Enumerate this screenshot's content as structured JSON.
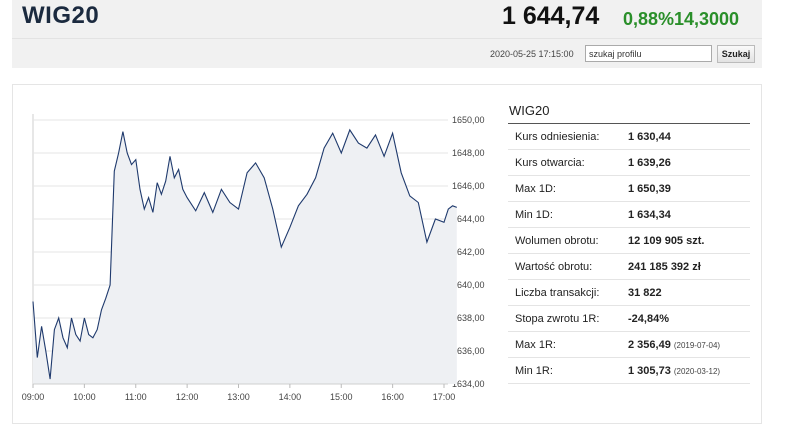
{
  "header": {
    "title": "WIG20",
    "price": "1 644,74",
    "change_pct": "0,88%",
    "change_abs": "14,3000",
    "timestamp": "2020-05-25 17:15:00",
    "search_placeholder": "szukaj profilu",
    "search_button": "Szukaj"
  },
  "stats": {
    "title": "WIG20",
    "rows": [
      {
        "label": "Kurs odniesienia:",
        "value": "1 630,44",
        "date": ""
      },
      {
        "label": "Kurs otwarcia:",
        "value": "1 639,26",
        "date": ""
      },
      {
        "label": "Max 1D:",
        "value": "1 650,39",
        "date": ""
      },
      {
        "label": "Min 1D:",
        "value": "1 634,34",
        "date": ""
      },
      {
        "label": "Wolumen obrotu:",
        "value": "12 109 905 szt.",
        "date": ""
      },
      {
        "label": "Wartość obrotu:",
        "value": "241 185 392 zł",
        "date": ""
      },
      {
        "label": "Liczba transakcji:",
        "value": "31 822",
        "date": ""
      },
      {
        "label": "Stopa zwrotu 1R:",
        "value": "-24,84%",
        "date": ""
      },
      {
        "label": "Max 1R:",
        "value": "2 356,49",
        "date": "(2019-07-04)"
      },
      {
        "label": "Min 1R:",
        "value": "1 305,73",
        "date": "(2020-03-12)"
      }
    ]
  },
  "colors": {
    "line": "#1f3a6d",
    "area": "#eef0f3",
    "up": "#2a8f2a"
  },
  "chart_data": {
    "type": "area",
    "title": "",
    "xlabel": "",
    "ylabel": "",
    "ylim": [
      1634,
      1650
    ],
    "xlim": [
      "09:00",
      "17:00"
    ],
    "y_ticks": [
      "1650,00",
      "1648,00",
      "1646,00",
      "1644,00",
      "1642,00",
      "1640,00",
      "1638,00",
      "1636,00",
      "1634,00"
    ],
    "x_ticks": [
      "09:00",
      "10:00",
      "11:00",
      "12:00",
      "13:00",
      "14:00",
      "15:00",
      "16:00",
      "17:00"
    ],
    "grid": true,
    "series": [
      {
        "x": [
          "09:00",
          "09:05",
          "09:10",
          "09:15",
          "09:20",
          "09:25",
          "09:30",
          "09:35",
          "09:40",
          "09:45",
          "09:50",
          "09:55",
          "10:00",
          "10:05",
          "10:10",
          "10:15",
          "10:20",
          "10:25",
          "10:30",
          "10:35",
          "10:40",
          "10:45",
          "10:50",
          "10:55",
          "11:00",
          "11:05",
          "11:10",
          "11:15",
          "11:20",
          "11:25",
          "11:30",
          "11:35",
          "11:40",
          "11:45",
          "11:50",
          "11:55",
          "12:00",
          "12:10",
          "12:20",
          "12:30",
          "12:40",
          "12:50",
          "13:00",
          "13:10",
          "13:20",
          "13:30",
          "13:40",
          "13:50",
          "14:00",
          "14:10",
          "14:20",
          "14:30",
          "14:40",
          "14:50",
          "15:00",
          "15:10",
          "15:20",
          "15:30",
          "15:40",
          "15:50",
          "16:00",
          "16:10",
          "16:20",
          "16:30",
          "16:40",
          "16:50",
          "17:00",
          "17:05",
          "17:10",
          "17:15"
        ],
        "values": [
          1639.0,
          1635.6,
          1637.5,
          1636.0,
          1634.3,
          1637.3,
          1638.0,
          1636.8,
          1636.2,
          1638.0,
          1637.0,
          1636.6,
          1638.0,
          1637.0,
          1636.8,
          1637.3,
          1638.5,
          1639.2,
          1640.0,
          1646.9,
          1648.0,
          1649.3,
          1648.0,
          1647.3,
          1647.6,
          1645.8,
          1644.6,
          1645.3,
          1644.4,
          1646.2,
          1645.5,
          1646.3,
          1647.8,
          1646.5,
          1647.0,
          1645.8,
          1645.3,
          1644.5,
          1645.6,
          1644.4,
          1645.8,
          1645.0,
          1644.6,
          1646.8,
          1647.4,
          1646.5,
          1644.6,
          1642.3,
          1643.5,
          1644.8,
          1645.5,
          1646.5,
          1648.3,
          1649.2,
          1648.0,
          1649.4,
          1648.6,
          1648.3,
          1649.1,
          1647.8,
          1649.2,
          1646.8,
          1645.4,
          1645.0,
          1642.6,
          1644.0,
          1643.8,
          1644.6,
          1644.8,
          1644.7
        ]
      }
    ]
  }
}
